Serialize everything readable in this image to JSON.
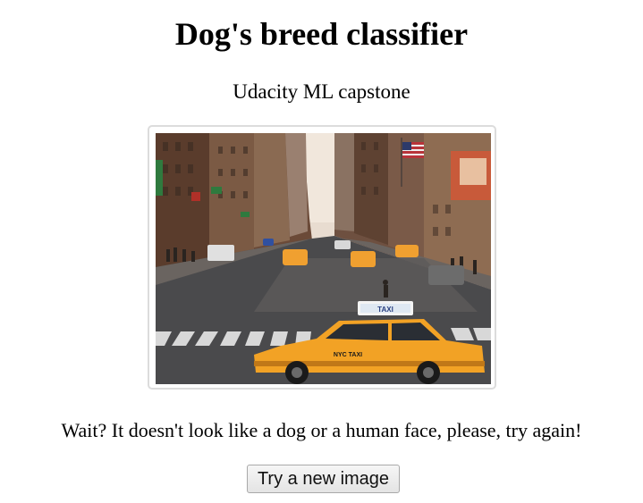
{
  "header": {
    "title": "Dog's breed classifier",
    "subtitle": "Udacity ML capstone"
  },
  "uploaded_image": {
    "description_icon": "city-street-taxi-photo"
  },
  "result": {
    "message": "Wait? It doesn't look like a dog or a human face, please, try again!"
  },
  "actions": {
    "retry_label": "Try a new image"
  },
  "photo_text": {
    "taxi_roof_sign": "TAXI",
    "taxi_door": "NYC TAXI"
  },
  "colors": {
    "taxi_yellow": "#f2a225",
    "asphalt": "#4a4a4c",
    "building_brown": "#6b4a38",
    "sky": "#e8dcd0"
  }
}
